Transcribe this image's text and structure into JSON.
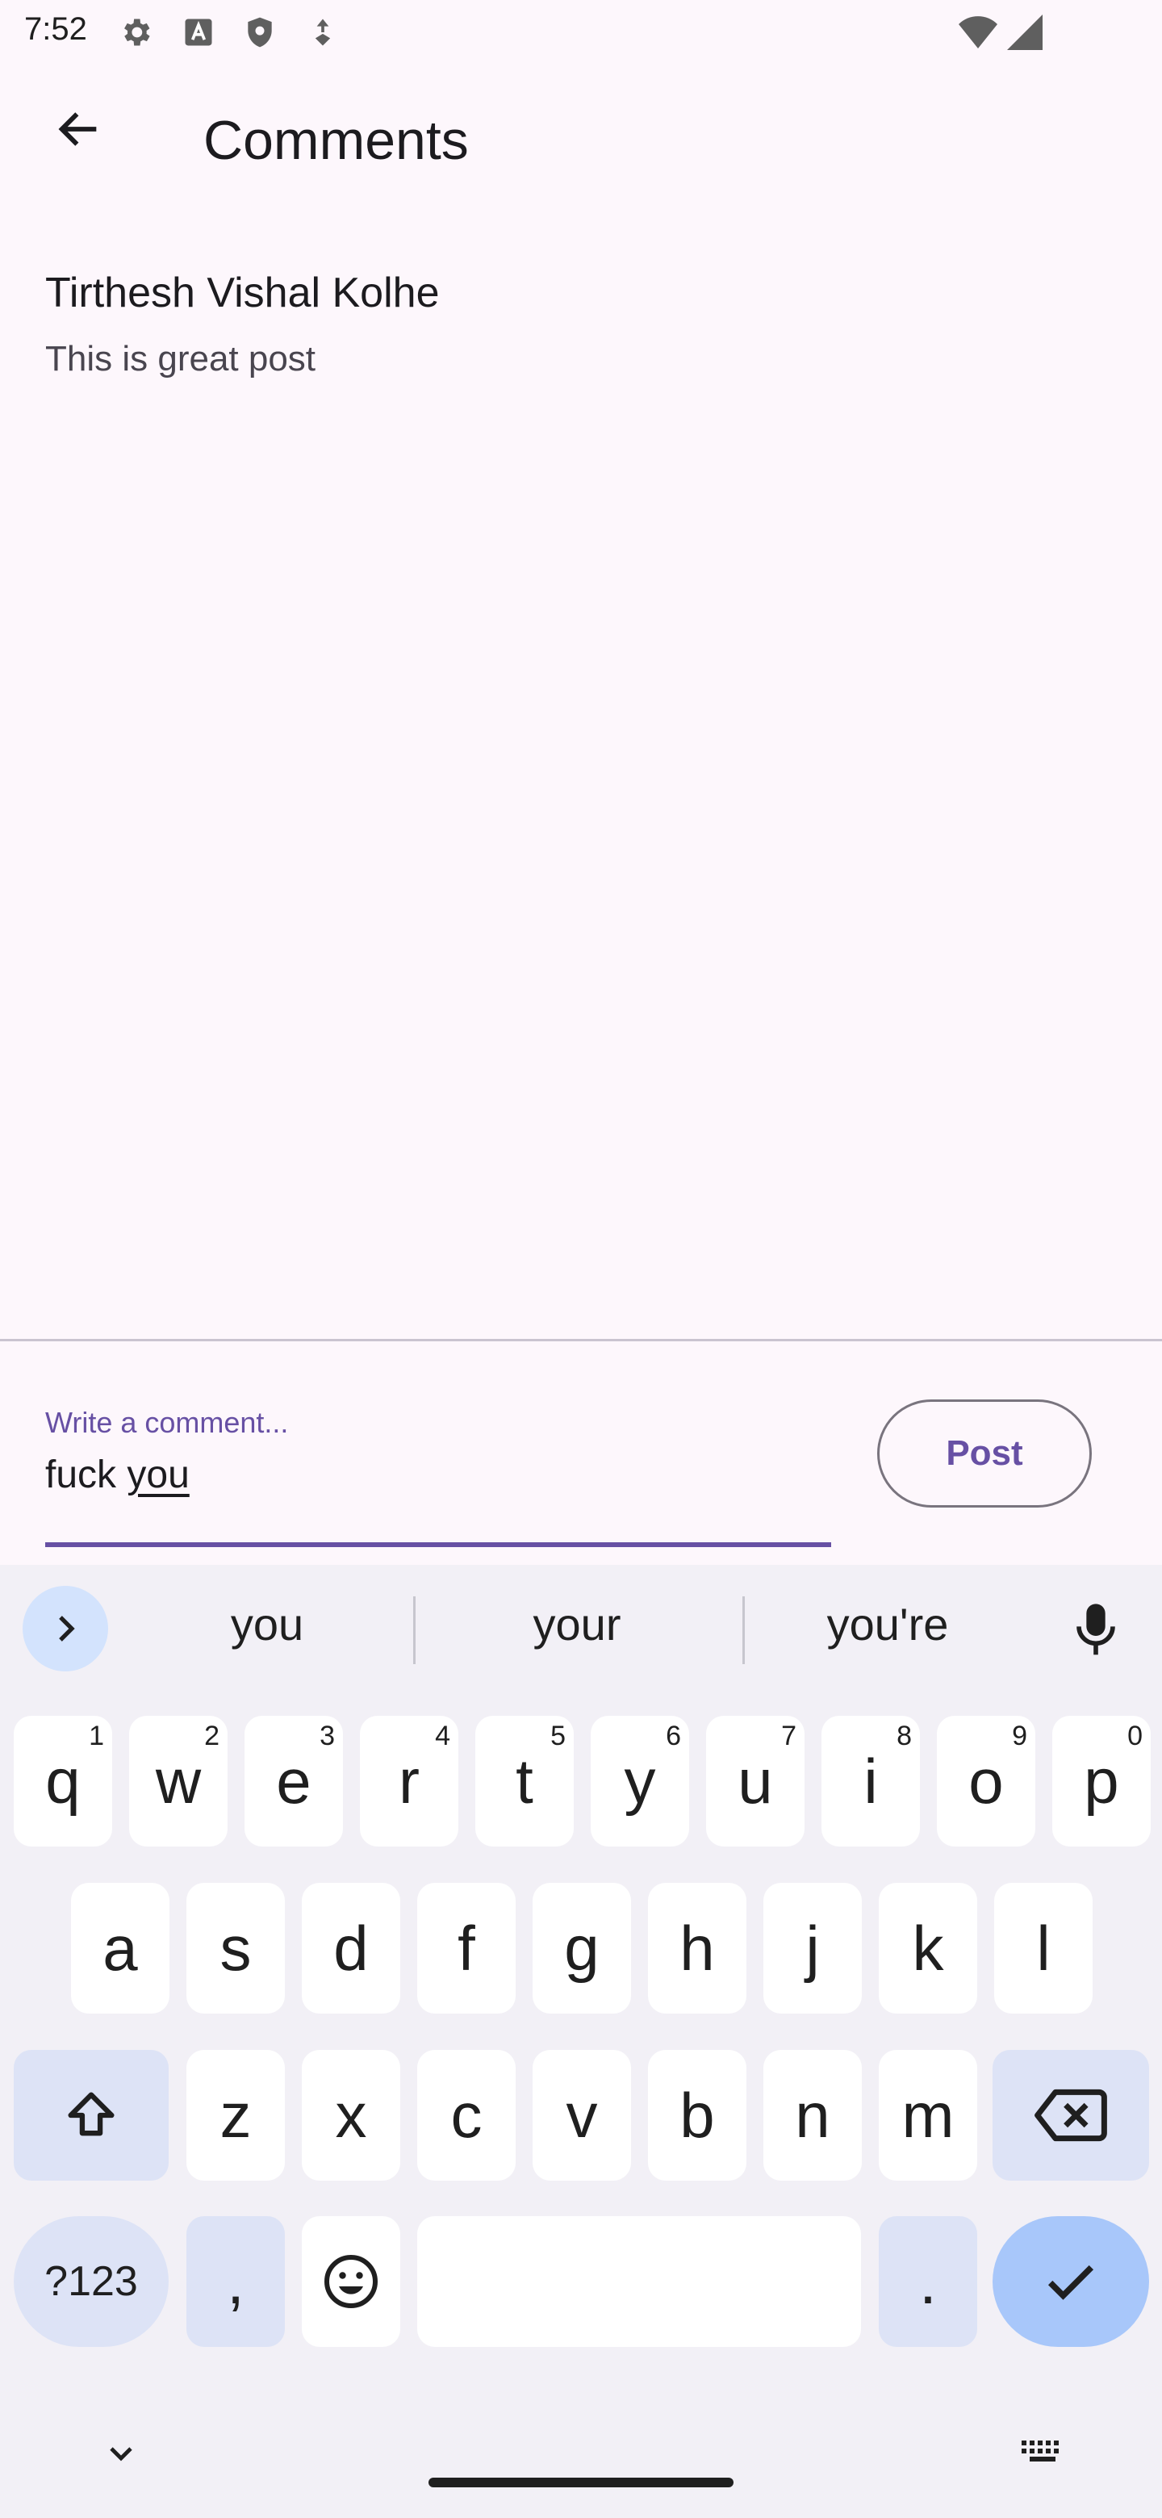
{
  "status_bar": {
    "time": "7:52",
    "icons": [
      "settings-icon",
      "a-icon",
      "shield-icon",
      "location-icon",
      "wifi-icon",
      "signal-icon"
    ]
  },
  "app_bar": {
    "back_icon": "arrow-back-icon",
    "title": "Comments"
  },
  "comments": [
    {
      "author": "Tirthesh Vishal Kolhe",
      "text": "This is great post"
    }
  ],
  "compose": {
    "label": "Write a comment...",
    "value_plain": "fuck ",
    "value_underlined": "you",
    "post_label": "Post"
  },
  "keyboard": {
    "suggestions": [
      "you",
      "your",
      "you're"
    ],
    "row1": [
      {
        "k": "q",
        "h": "1"
      },
      {
        "k": "w",
        "h": "2"
      },
      {
        "k": "e",
        "h": "3"
      },
      {
        "k": "r",
        "h": "4"
      },
      {
        "k": "t",
        "h": "5"
      },
      {
        "k": "y",
        "h": "6"
      },
      {
        "k": "u",
        "h": "7"
      },
      {
        "k": "i",
        "h": "8"
      },
      {
        "k": "o",
        "h": "9"
      },
      {
        "k": "p",
        "h": "0"
      }
    ],
    "row2": [
      "a",
      "s",
      "d",
      "f",
      "g",
      "h",
      "j",
      "k",
      "l"
    ],
    "row3": [
      "z",
      "x",
      "c",
      "v",
      "b",
      "n",
      "m"
    ],
    "symbols_label": "?123",
    "comma": ",",
    "period": "."
  },
  "colors": {
    "accent": "#6750a4",
    "background": "#fdf7fc",
    "keyboard_bg": "#f2f0f6",
    "enter_key": "#a8c7fa",
    "mod_key": "#dde3f6"
  }
}
